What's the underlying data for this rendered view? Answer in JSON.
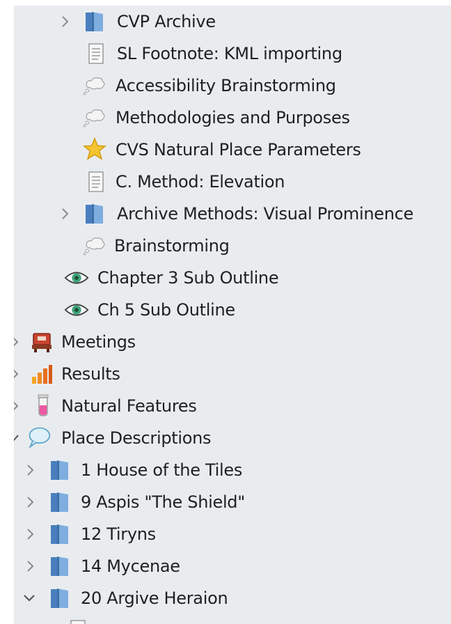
{
  "tree": {
    "items": [
      {
        "label": "CVP Archive",
        "icon": "folder-icon",
        "expander": "collapsed",
        "depth": 3
      },
      {
        "label": "SL Footnote: KML importing",
        "icon": "document-icon",
        "expander": "none",
        "depth": 3
      },
      {
        "label": "Accessibility Brainstorming",
        "icon": "thought-cloud-icon",
        "expander": "none",
        "depth": 3
      },
      {
        "label": "Methodologies and Purposes",
        "icon": "thought-cloud-icon",
        "expander": "none",
        "depth": 3
      },
      {
        "label": "CVS Natural Place Parameters",
        "icon": "star-icon",
        "expander": "none",
        "depth": 3
      },
      {
        "label": "C. Method: Elevation",
        "icon": "document-icon",
        "expander": "none",
        "depth": 3
      },
      {
        "label": "Archive Methods: Visual Prominence",
        "icon": "folder-icon",
        "expander": "collapsed",
        "depth": 3
      },
      {
        "label": "Brainstorming",
        "icon": "thought-cloud-icon",
        "expander": "none",
        "depth": 3
      },
      {
        "label": "Chapter 3 Sub Outline",
        "icon": "eye-icon",
        "expander": "none",
        "depth": 2
      },
      {
        "label": "Ch 5 Sub Outline",
        "icon": "eye-icon",
        "expander": "none",
        "depth": 2
      },
      {
        "label": "Meetings",
        "icon": "meeting-icon",
        "expander": "collapsed",
        "depth": 1
      },
      {
        "label": "Results",
        "icon": "bar-chart-icon",
        "expander": "collapsed",
        "depth": 1
      },
      {
        "label": "Natural Features",
        "icon": "test-tube-icon",
        "expander": "collapsed",
        "depth": 1
      },
      {
        "label": "Place Descriptions",
        "icon": "speech-bubble-icon",
        "expander": "expanded",
        "depth": 1
      },
      {
        "label": "1 House of the Tiles",
        "icon": "folder-icon",
        "expander": "collapsed",
        "depth": 2
      },
      {
        "label": "9 Aspis \"The Shield\"",
        "icon": "folder-icon",
        "expander": "collapsed",
        "depth": 2
      },
      {
        "label": "12 Tiryns",
        "icon": "folder-icon",
        "expander": "collapsed",
        "depth": 2
      },
      {
        "label": "14 Mycenae",
        "icon": "folder-icon",
        "expander": "collapsed",
        "depth": 2
      },
      {
        "label": "20 Argive Heraion",
        "icon": "folder-icon",
        "expander": "expanded",
        "depth": 2
      }
    ]
  },
  "colors": {
    "panel_bg": "#e9ecef",
    "text": "#1f1f1f",
    "chevron": "#8a8a8a",
    "folder_blue": "#6f9fd3",
    "star_yellow": "#f4c430"
  }
}
